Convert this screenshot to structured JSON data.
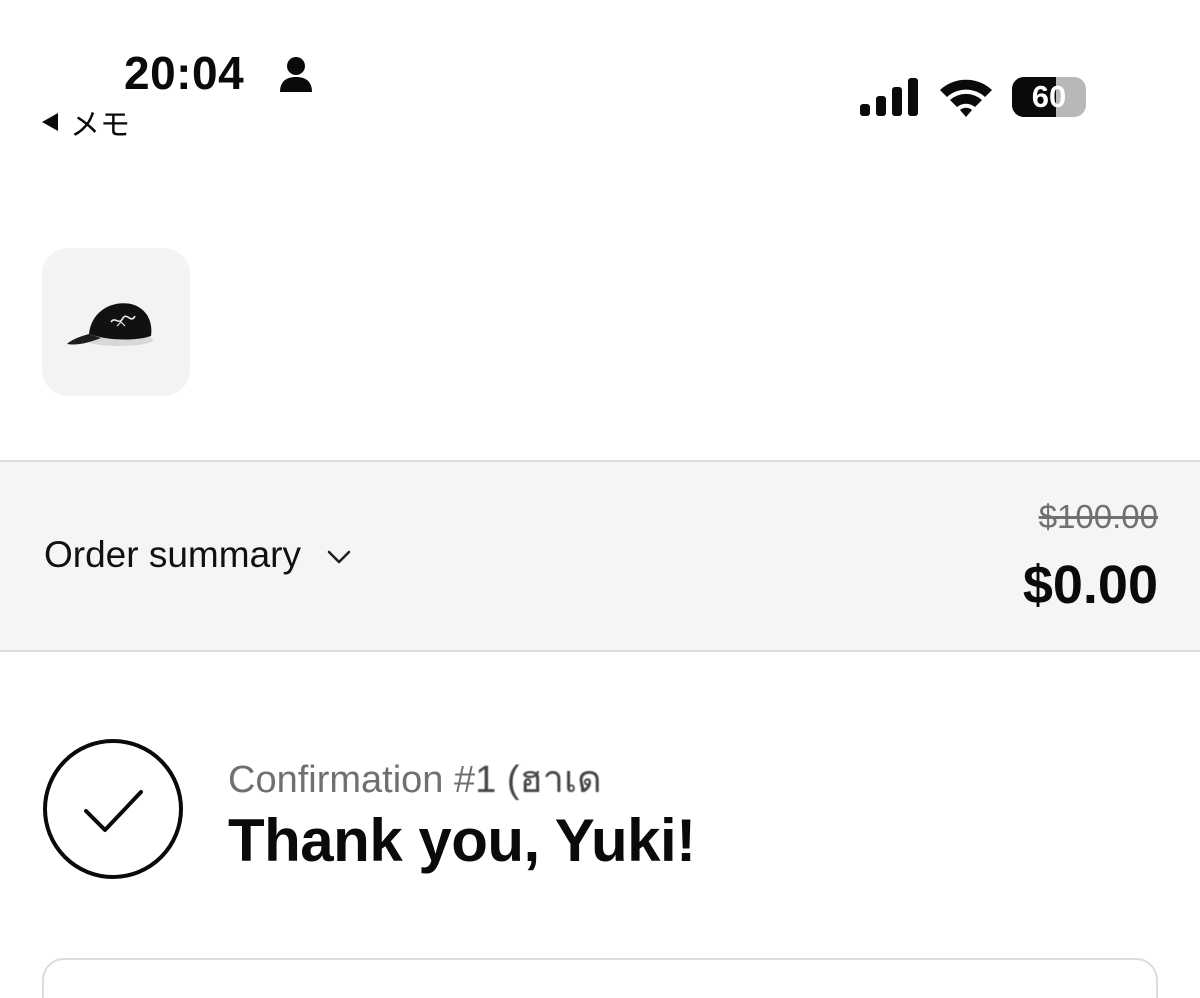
{
  "status_bar": {
    "time": "20:04",
    "back_app": "メモ",
    "battery_level": "60",
    "battery_fraction": 0.6
  },
  "product": {
    "icon": "cap-icon"
  },
  "order_summary": {
    "label": "Order summary",
    "original_price": "$100.00",
    "total": "$0.00"
  },
  "confirmation": {
    "number_prefix": "Confirmation #",
    "number_value": "1 (ฮาเด",
    "thank_you": "Thank you, Yuki!"
  }
}
